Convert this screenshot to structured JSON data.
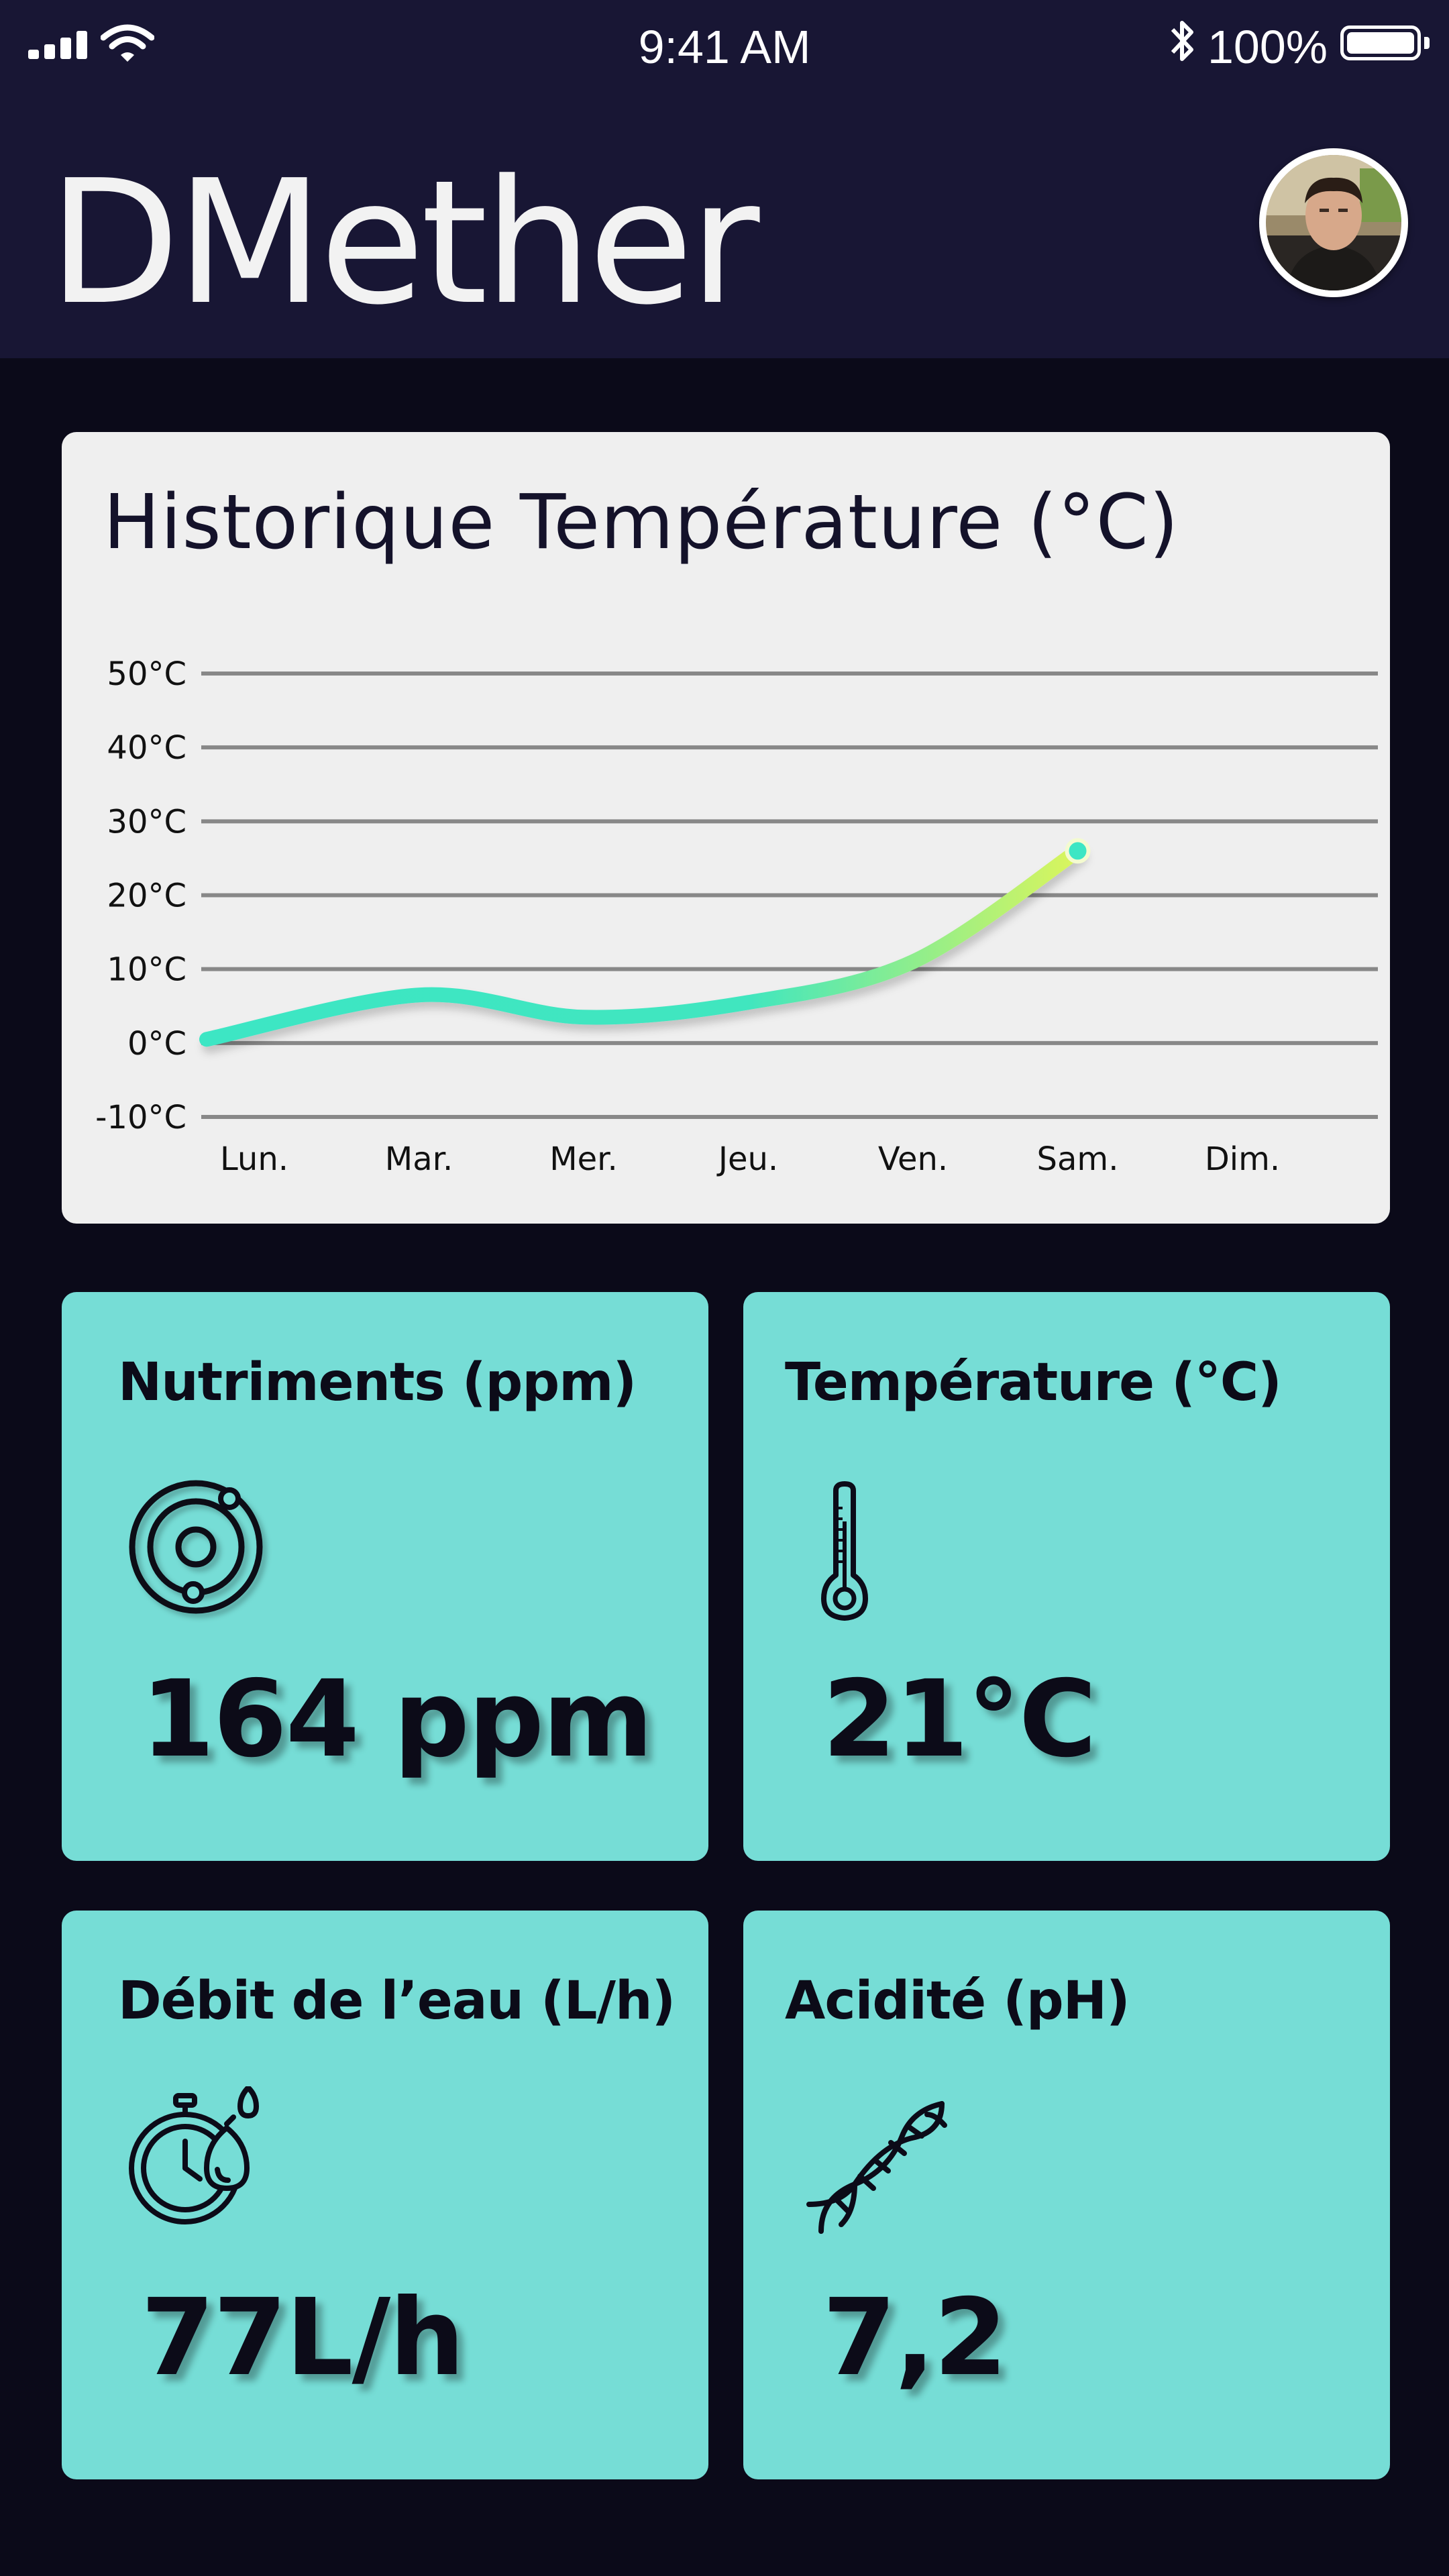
{
  "status_bar": {
    "time": "9:41 AM",
    "battery_percent": "100%",
    "battery_level": 1.0,
    "icons": [
      "signal-icon",
      "wifi-icon",
      "bluetooth-icon",
      "battery-icon"
    ]
  },
  "header": {
    "app_title": "DMether",
    "avatar_icon": "user-avatar"
  },
  "chart": {
    "title": "Historique Température (°C)"
  },
  "chart_data": {
    "type": "line",
    "title": "Historique Température (°C)",
    "categories": [
      "Lun.",
      "Mar.",
      "Mer.",
      "Jeu.",
      "Ven.",
      "Sam.",
      "Dim."
    ],
    "y_tick_labels": [
      "50°C",
      "40°C",
      "30°C",
      "20°C",
      "10°C",
      "0°C",
      "-10°C"
    ],
    "y_ticks": [
      50,
      40,
      30,
      20,
      10,
      0,
      -10
    ],
    "ylim": [
      -10,
      50
    ],
    "grid": true,
    "series": [
      {
        "values": [
          0.5,
          6.5,
          3.5,
          5.5,
          11,
          26,
          null
        ]
      }
    ],
    "colors": {
      "line_start": "#3de6c4",
      "line_end": "#dbf55c",
      "grid": "#888888"
    }
  },
  "cards": [
    {
      "label": "Nutriments (ppm)",
      "value": "164 ppm",
      "icon": "nutrients-orbit-icon"
    },
    {
      "label": "Température (°C)",
      "value": "21°C",
      "icon": "thermometer-icon"
    },
    {
      "label": "Débit de l’eau (L/h)",
      "value": "77L/h",
      "icon": "water-flow-stopwatch-icon"
    },
    {
      "label": "Acidité (pH)",
      "value": "7,2",
      "icon": "dna-icon"
    }
  ],
  "colors": {
    "header_bg": "#181634",
    "page_bg": "#0b0a19",
    "card_bg": "#76ddd6",
    "chart_card_bg": "#efefef"
  }
}
